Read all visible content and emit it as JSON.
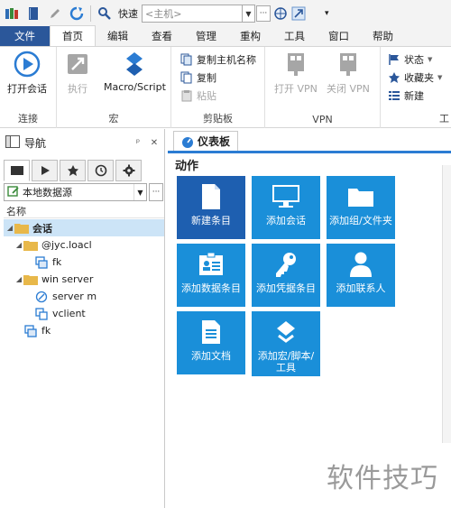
{
  "quick_access": {
    "quick_label": "快速",
    "host_combo_value": "<主机>",
    "more_label": "···",
    "overflow_label": "▾"
  },
  "menu_tabs": [
    {
      "label": "文件"
    },
    {
      "label": "首页"
    },
    {
      "label": "编辑"
    },
    {
      "label": "查看"
    },
    {
      "label": "管理"
    },
    {
      "label": "重构"
    },
    {
      "label": "工具"
    },
    {
      "label": "窗口"
    },
    {
      "label": "帮助"
    }
  ],
  "ribbon": {
    "connect": {
      "open_session": "打开会话",
      "group_label": "连接"
    },
    "macro": {
      "execute": "执行",
      "macro_script": "Macro/Script",
      "group_label": "宏"
    },
    "clipboard": {
      "copy_host_name": "复制主机名称",
      "copy": "复制",
      "paste": "粘贴",
      "group_label": "剪贴板"
    },
    "vpn": {
      "open_vpn": "打开 VPN",
      "close_vpn": "关闭 VPN",
      "group_label": "VPN"
    },
    "tools": {
      "status": "状态",
      "favorites": "收藏夹",
      "new": "新建",
      "group_label_partial": "工"
    }
  },
  "navigation": {
    "title": "导航",
    "pin": "ᵖ",
    "close": "✕",
    "datasource": "本地数据源",
    "more_label": "···",
    "column_name": "名称",
    "tree": [
      {
        "label": "会话",
        "level": 0,
        "type": "folder",
        "selected": true
      },
      {
        "label": "@jyc.loacl",
        "level": 1,
        "type": "folder"
      },
      {
        "label": "fk",
        "level": 2,
        "type": "rdp"
      },
      {
        "label": "win server",
        "level": 1,
        "type": "folder"
      },
      {
        "label": "server m",
        "level": 2,
        "type": "web"
      },
      {
        "label": "vclient",
        "level": 2,
        "type": "vm"
      },
      {
        "label": "fk",
        "level": 1,
        "type": "rdp"
      }
    ]
  },
  "dashboard": {
    "tab_label": "仪表板",
    "section_title": "动作",
    "tiles": [
      {
        "label": "新建条目",
        "icon": "new-entry-icon"
      },
      {
        "label": "添加会话",
        "icon": "monitor-icon"
      },
      {
        "label": "添加组/文件夹",
        "icon": "folder-icon"
      },
      {
        "label": "添加数据条目",
        "icon": "id-card-icon"
      },
      {
        "label": "添加凭据条目",
        "icon": "key-icon"
      },
      {
        "label": "添加联系人",
        "icon": "person-icon"
      },
      {
        "label": "添加文档",
        "icon": "document-icon"
      },
      {
        "label": "添加宏/脚本/工具",
        "icon": "wrench-icon"
      }
    ]
  },
  "watermark": "软件技巧",
  "colors": {
    "file_tab": "#2b579a",
    "tile_blue": "#1a8fd9",
    "tile_dark": "#1e5fb0",
    "selection": "#cce4f7"
  }
}
